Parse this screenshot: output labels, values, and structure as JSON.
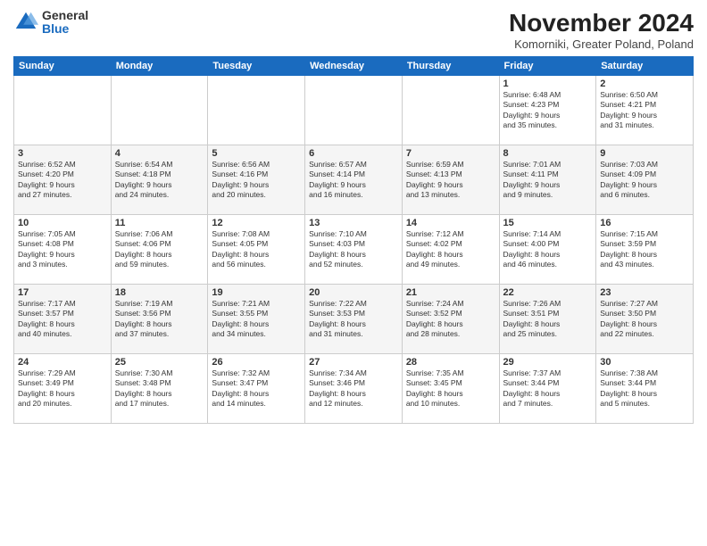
{
  "logo": {
    "general": "General",
    "blue": "Blue"
  },
  "title": "November 2024",
  "subtitle": "Komorniki, Greater Poland, Poland",
  "headers": [
    "Sunday",
    "Monday",
    "Tuesday",
    "Wednesday",
    "Thursday",
    "Friday",
    "Saturday"
  ],
  "weeks": [
    [
      {
        "day": "",
        "info": ""
      },
      {
        "day": "",
        "info": ""
      },
      {
        "day": "",
        "info": ""
      },
      {
        "day": "",
        "info": ""
      },
      {
        "day": "",
        "info": ""
      },
      {
        "day": "1",
        "info": "Sunrise: 6:48 AM\nSunset: 4:23 PM\nDaylight: 9 hours\nand 35 minutes."
      },
      {
        "day": "2",
        "info": "Sunrise: 6:50 AM\nSunset: 4:21 PM\nDaylight: 9 hours\nand 31 minutes."
      }
    ],
    [
      {
        "day": "3",
        "info": "Sunrise: 6:52 AM\nSunset: 4:20 PM\nDaylight: 9 hours\nand 27 minutes."
      },
      {
        "day": "4",
        "info": "Sunrise: 6:54 AM\nSunset: 4:18 PM\nDaylight: 9 hours\nand 24 minutes."
      },
      {
        "day": "5",
        "info": "Sunrise: 6:56 AM\nSunset: 4:16 PM\nDaylight: 9 hours\nand 20 minutes."
      },
      {
        "day": "6",
        "info": "Sunrise: 6:57 AM\nSunset: 4:14 PM\nDaylight: 9 hours\nand 16 minutes."
      },
      {
        "day": "7",
        "info": "Sunrise: 6:59 AM\nSunset: 4:13 PM\nDaylight: 9 hours\nand 13 minutes."
      },
      {
        "day": "8",
        "info": "Sunrise: 7:01 AM\nSunset: 4:11 PM\nDaylight: 9 hours\nand 9 minutes."
      },
      {
        "day": "9",
        "info": "Sunrise: 7:03 AM\nSunset: 4:09 PM\nDaylight: 9 hours\nand 6 minutes."
      }
    ],
    [
      {
        "day": "10",
        "info": "Sunrise: 7:05 AM\nSunset: 4:08 PM\nDaylight: 9 hours\nand 3 minutes."
      },
      {
        "day": "11",
        "info": "Sunrise: 7:06 AM\nSunset: 4:06 PM\nDaylight: 8 hours\nand 59 minutes."
      },
      {
        "day": "12",
        "info": "Sunrise: 7:08 AM\nSunset: 4:05 PM\nDaylight: 8 hours\nand 56 minutes."
      },
      {
        "day": "13",
        "info": "Sunrise: 7:10 AM\nSunset: 4:03 PM\nDaylight: 8 hours\nand 52 minutes."
      },
      {
        "day": "14",
        "info": "Sunrise: 7:12 AM\nSunset: 4:02 PM\nDaylight: 8 hours\nand 49 minutes."
      },
      {
        "day": "15",
        "info": "Sunrise: 7:14 AM\nSunset: 4:00 PM\nDaylight: 8 hours\nand 46 minutes."
      },
      {
        "day": "16",
        "info": "Sunrise: 7:15 AM\nSunset: 3:59 PM\nDaylight: 8 hours\nand 43 minutes."
      }
    ],
    [
      {
        "day": "17",
        "info": "Sunrise: 7:17 AM\nSunset: 3:57 PM\nDaylight: 8 hours\nand 40 minutes."
      },
      {
        "day": "18",
        "info": "Sunrise: 7:19 AM\nSunset: 3:56 PM\nDaylight: 8 hours\nand 37 minutes."
      },
      {
        "day": "19",
        "info": "Sunrise: 7:21 AM\nSunset: 3:55 PM\nDaylight: 8 hours\nand 34 minutes."
      },
      {
        "day": "20",
        "info": "Sunrise: 7:22 AM\nSunset: 3:53 PM\nDaylight: 8 hours\nand 31 minutes."
      },
      {
        "day": "21",
        "info": "Sunrise: 7:24 AM\nSunset: 3:52 PM\nDaylight: 8 hours\nand 28 minutes."
      },
      {
        "day": "22",
        "info": "Sunrise: 7:26 AM\nSunset: 3:51 PM\nDaylight: 8 hours\nand 25 minutes."
      },
      {
        "day": "23",
        "info": "Sunrise: 7:27 AM\nSunset: 3:50 PM\nDaylight: 8 hours\nand 22 minutes."
      }
    ],
    [
      {
        "day": "24",
        "info": "Sunrise: 7:29 AM\nSunset: 3:49 PM\nDaylight: 8 hours\nand 20 minutes."
      },
      {
        "day": "25",
        "info": "Sunrise: 7:30 AM\nSunset: 3:48 PM\nDaylight: 8 hours\nand 17 minutes."
      },
      {
        "day": "26",
        "info": "Sunrise: 7:32 AM\nSunset: 3:47 PM\nDaylight: 8 hours\nand 14 minutes."
      },
      {
        "day": "27",
        "info": "Sunrise: 7:34 AM\nSunset: 3:46 PM\nDaylight: 8 hours\nand 12 minutes."
      },
      {
        "day": "28",
        "info": "Sunrise: 7:35 AM\nSunset: 3:45 PM\nDaylight: 8 hours\nand 10 minutes."
      },
      {
        "day": "29",
        "info": "Sunrise: 7:37 AM\nSunset: 3:44 PM\nDaylight: 8 hours\nand 7 minutes."
      },
      {
        "day": "30",
        "info": "Sunrise: 7:38 AM\nSunset: 3:44 PM\nDaylight: 8 hours\nand 5 minutes."
      }
    ]
  ]
}
